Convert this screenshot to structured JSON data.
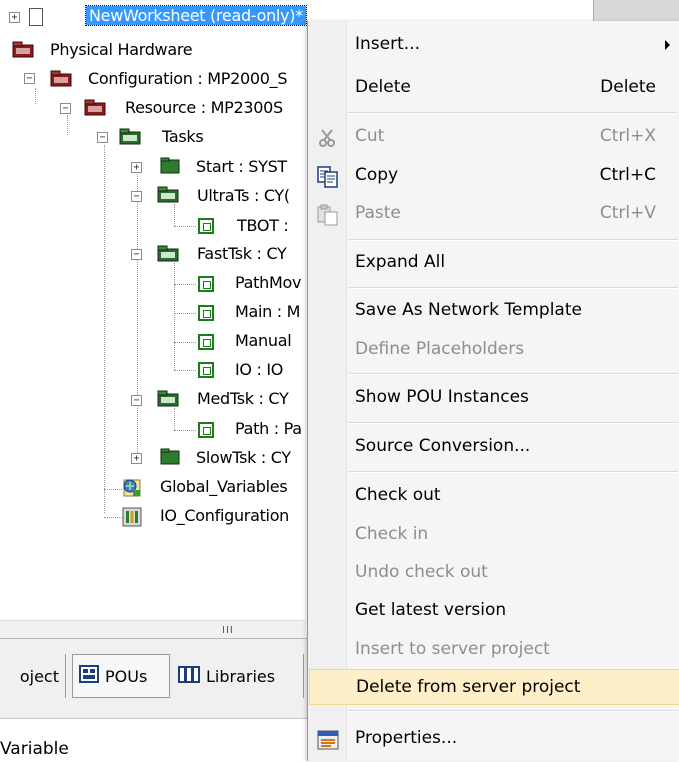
{
  "tree": {
    "items": [
      {
        "label": "NewWorksheet (read-only)*"
      },
      {
        "label": "Physical Hardware"
      },
      {
        "label": "Configuration : MP2000_S"
      },
      {
        "label": "Resource : MP2300S"
      },
      {
        "label": "Tasks"
      },
      {
        "label": "Start : SYST"
      },
      {
        "label": "UltraTs : CY("
      },
      {
        "label": "TBOT :"
      },
      {
        "label": "FastTsk : CY"
      },
      {
        "label": "PathMov"
      },
      {
        "label": "Main : M"
      },
      {
        "label": "Manual"
      },
      {
        "label": "IO : IO"
      },
      {
        "label": "MedTsk : CY"
      },
      {
        "label": "Path : Pa"
      },
      {
        "label": "SlowTsk : CY"
      },
      {
        "label": "Global_Variables"
      },
      {
        "label": "IO_Configuration"
      }
    ],
    "scroll_grip": "III"
  },
  "tabs": [
    {
      "label": "oject"
    },
    {
      "label": "POUs"
    },
    {
      "label": "Libraries"
    }
  ],
  "bottom_label": "Variable",
  "menu": {
    "items": [
      {
        "label": "Insert...",
        "shortcut": "",
        "icon": "",
        "enabled": true
      },
      {
        "label": "Delete",
        "shortcut": "Delete",
        "icon": "",
        "enabled": true
      },
      {
        "label": "Cut",
        "shortcut": "Ctrl+X",
        "icon": "scissors-icon",
        "enabled": false
      },
      {
        "label": "Copy",
        "shortcut": "Ctrl+C",
        "icon": "copy-icon",
        "enabled": true
      },
      {
        "label": "Paste",
        "shortcut": "Ctrl+V",
        "icon": "paste-icon",
        "enabled": false
      },
      {
        "label": "Expand All",
        "shortcut": "",
        "icon": "",
        "enabled": true
      },
      {
        "label": "Save As Network Template",
        "shortcut": "",
        "icon": "",
        "enabled": true
      },
      {
        "label": "Define Placeholders",
        "shortcut": "",
        "icon": "",
        "enabled": false
      },
      {
        "label": "Show POU Instances",
        "shortcut": "",
        "icon": "",
        "enabled": true
      },
      {
        "label": "Source Conversion...",
        "shortcut": "",
        "icon": "",
        "enabled": true
      },
      {
        "label": "Check out",
        "shortcut": "",
        "icon": "",
        "enabled": true
      },
      {
        "label": "Check in",
        "shortcut": "",
        "icon": "",
        "enabled": false
      },
      {
        "label": "Undo check out",
        "shortcut": "",
        "icon": "",
        "enabled": false
      },
      {
        "label": "Get latest version",
        "shortcut": "",
        "icon": "",
        "enabled": true
      },
      {
        "label": "Insert to server project",
        "shortcut": "",
        "icon": "",
        "enabled": false
      },
      {
        "label": "Delete from server project",
        "shortcut": "",
        "icon": "",
        "enabled": true,
        "highlighted": true
      },
      {
        "label": "Properties...",
        "shortcut": "",
        "icon": "properties-icon",
        "enabled": true
      }
    ]
  },
  "colors": {
    "selection": "#3399ff",
    "menu_highlight": "#fdf0c8",
    "disabled_text": "#8d8d8d"
  }
}
